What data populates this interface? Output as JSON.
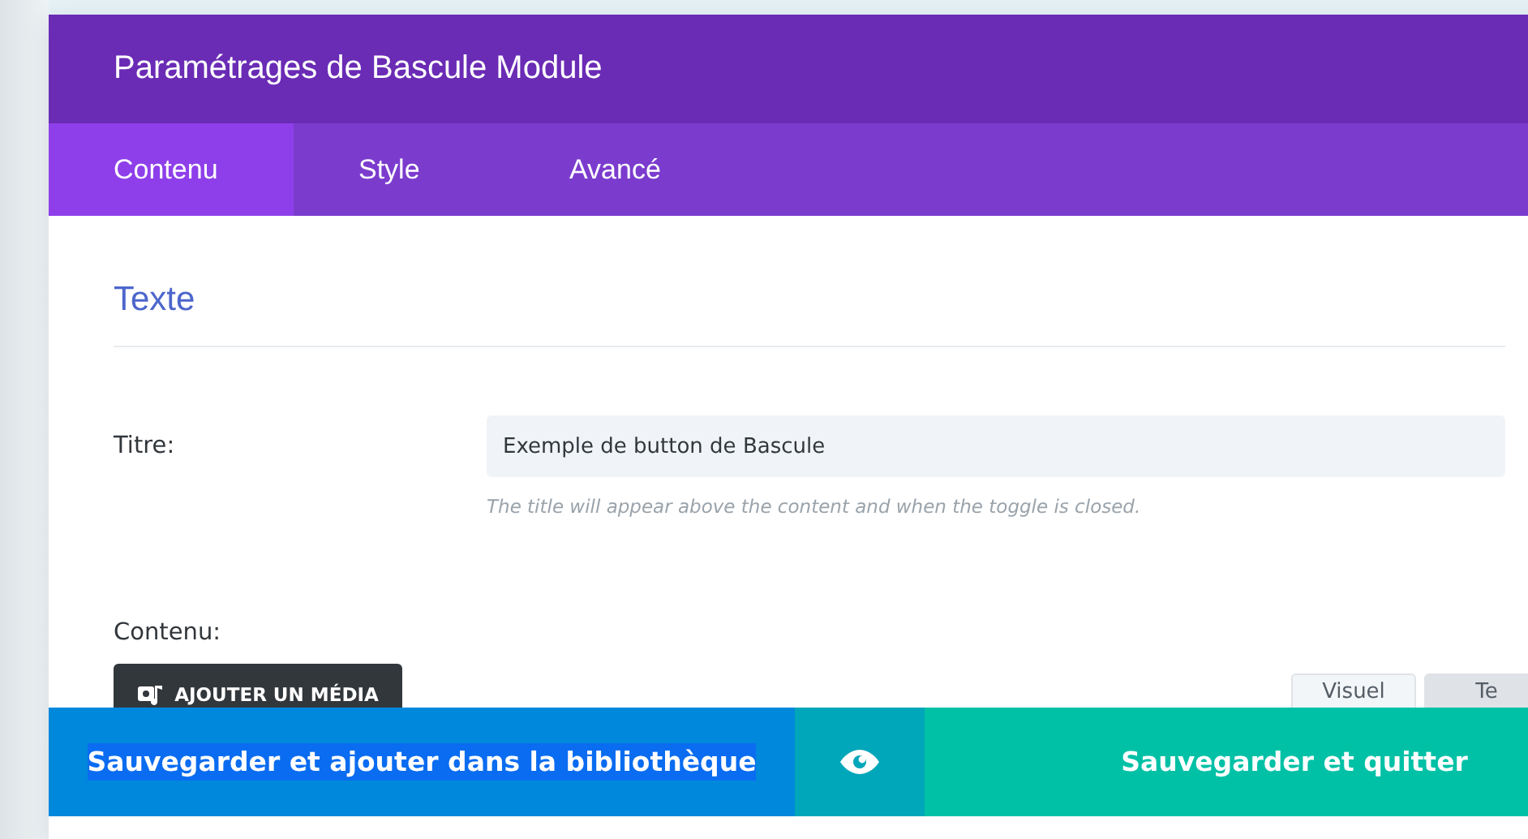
{
  "modal": {
    "title": "Paramétrages de Bascule Module"
  },
  "tabs": [
    {
      "label": "Contenu",
      "selected": true
    },
    {
      "label": "Style",
      "selected": false
    },
    {
      "label": "Avancé",
      "selected": false
    }
  ],
  "section": {
    "title": "Texte"
  },
  "title_field": {
    "label": "Titre:",
    "value": "Exemple de button de Bascule",
    "hint": "The title will appear above the content and when the toggle is closed."
  },
  "content_field": {
    "label": "Contenu:",
    "media_button": "AJOUTER UN MÉDIA",
    "editor_tabs": [
      {
        "label": "Visuel",
        "selected": true
      },
      {
        "label": "Te",
        "selected": false
      }
    ]
  },
  "footer": {
    "save_library": "Sauvegarder et ajouter dans la bibliothèque",
    "save_library_text_selected": true,
    "save_quit": "Sauvegarder et quitter"
  }
}
